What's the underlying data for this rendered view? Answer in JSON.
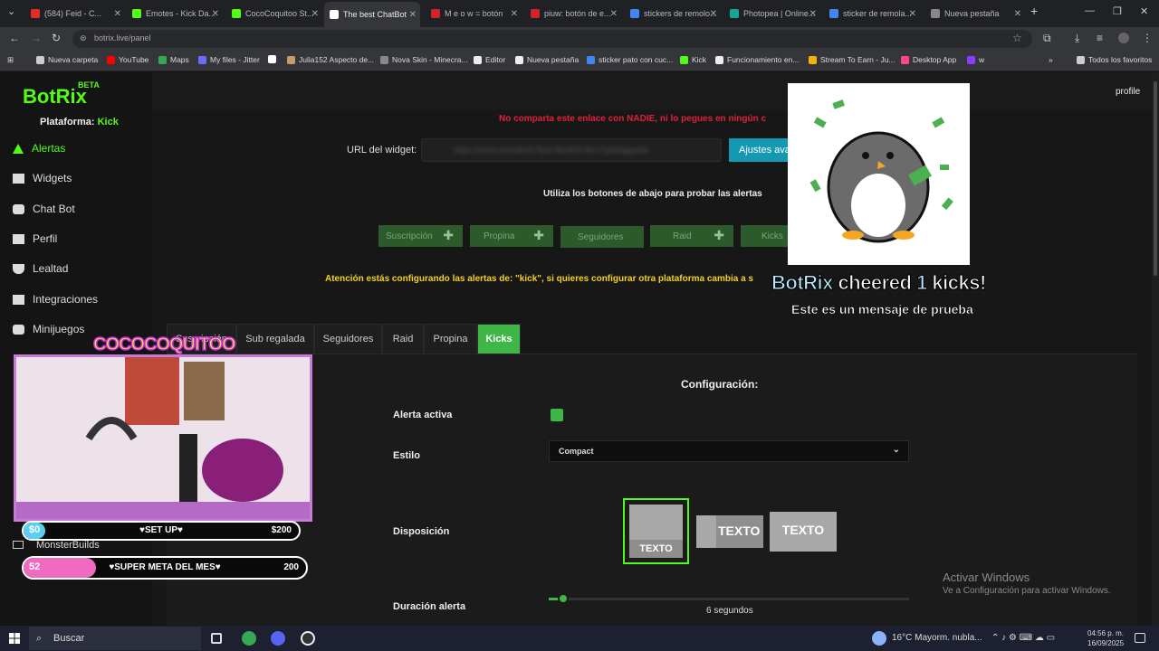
{
  "browser": {
    "tabs": [
      {
        "label": "(584) Feid - C...",
        "fav": "#e52d27"
      },
      {
        "label": "Emotes - Kick Da...",
        "fav": "#53fc18"
      },
      {
        "label": "CocoCoquitoo St...",
        "fav": "#53fc18"
      },
      {
        "label": "The best ChatBot",
        "fav": "#ffffff"
      },
      {
        "label": "M e o w = botón",
        "fav": "#d0242a"
      },
      {
        "label": "piuw: botón de e...",
        "fav": "#d0242a"
      },
      {
        "label": "stickers de remolo...",
        "fav": "#4285f4"
      },
      {
        "label": "Photopea | Online...",
        "fav": "#18a497"
      },
      {
        "label": "sticker de remola...",
        "fav": "#4285f4"
      },
      {
        "label": "Nueva pestaña",
        "fav": "#888888"
      }
    ],
    "url": "botrix.live/panel",
    "bookmarks": [
      {
        "label": "Nueva carpeta",
        "color": "#cccccc"
      },
      {
        "label": "YouTube",
        "color": "#ff0000"
      },
      {
        "label": "Maps",
        "color": "#34a853"
      },
      {
        "label": "My files - Jitter",
        "color": "#6c6cff"
      },
      {
        "label": "",
        "color": "#ffffff"
      },
      {
        "label": "Julia152 Aspecto de...",
        "color": "#c69c6d"
      },
      {
        "label": "Nova Skin - Minecra...",
        "color": "#888888"
      },
      {
        "label": "Editor",
        "color": "#eeeeee"
      },
      {
        "label": "Nueva pestaña",
        "color": "#eeeeee"
      },
      {
        "label": "sticker pato con cuc...",
        "color": "#4285f4"
      },
      {
        "label": "Kick",
        "color": "#53fc18"
      },
      {
        "label": "Funcionamiento en...",
        "color": "#eeeeee"
      },
      {
        "label": "Stream To Earn - Ju...",
        "color": "#f5b400"
      },
      {
        "label": "Desktop App",
        "color": "#ff4488"
      },
      {
        "label": "w",
        "color": "#8b3dff"
      }
    ],
    "all_bookmarks": "Todos los favoritos"
  },
  "app": {
    "logo": "BotRix",
    "beta": "BETA",
    "platform_label": "Plataforma:",
    "platform_value": "Kick",
    "profile": "profile",
    "nav": [
      {
        "label": "Alertas",
        "active": true
      },
      {
        "label": "Widgets",
        "active": false
      },
      {
        "label": "Chat Bot",
        "active": false
      },
      {
        "label": "Perfil",
        "active": false
      },
      {
        "label": "Lealtad",
        "active": false
      },
      {
        "label": "Integraciones",
        "active": false
      },
      {
        "label": "Minijuegos",
        "active": false
      }
    ]
  },
  "main": {
    "warning": "No comparta este enlace con NADIE, ni lo pegues en ningún c",
    "url_label": "URL del widget:",
    "url_value": "https://botrix.live/alerts?bid=8eeR3Y2b17Qa09ggwt6e",
    "advanced_button": "Ajustes avanzados",
    "instructions": "Utiliza los botones de abajo para probar las alertas",
    "test_buttons": [
      "Suscripción",
      "Propina",
      "Seguidores",
      "Raid",
      "Kicks"
    ],
    "attention": "Atención estás configurando las alertas de: \"kick\", si quieres configurar otra plataforma cambia a s",
    "tabs": [
      "Suscripción",
      "Sub regalada",
      "Seguidores",
      "Raid",
      "Propina",
      "Kicks"
    ],
    "active_tab": "Kicks",
    "config_title": "Configuración:",
    "fields": {
      "active_label": "Alerta activa",
      "active_checked": true,
      "style_label": "Estilo",
      "style_value": "Compact",
      "layout_label": "Disposición",
      "layout_text": "TEXTO",
      "duration_label": "Duración alerta",
      "duration_value": "6 segundos",
      "duration_fraction": 0.04
    }
  },
  "alert_overlay": {
    "name": "BotRix",
    "title_rest": "cheered",
    "amount": "1",
    "unit": "kicks!",
    "message": "Este es un mensaje de prueba"
  },
  "stream_overlay": {
    "title": "COCOCOQUITOO",
    "bar1_left": "$0",
    "bar1_mid": "♥SET UP♥",
    "bar1_goal": "$200",
    "bar1_fraction": 0.02,
    "bar2_left": "52",
    "bar2_mid": "♥SUPER META DEL MES♥",
    "bar2_goal": "200",
    "bar2_fraction": 0.26,
    "monster": "MonsterBuilds"
  },
  "windows": {
    "activate_title": "Activar Windows",
    "activate_sub": "Ve a Configuración para activar Windows.",
    "search": "Buscar",
    "weather": "16°C  Mayorm. nubla...",
    "time": "04:56 p. m.",
    "date": "16/09/2025"
  }
}
